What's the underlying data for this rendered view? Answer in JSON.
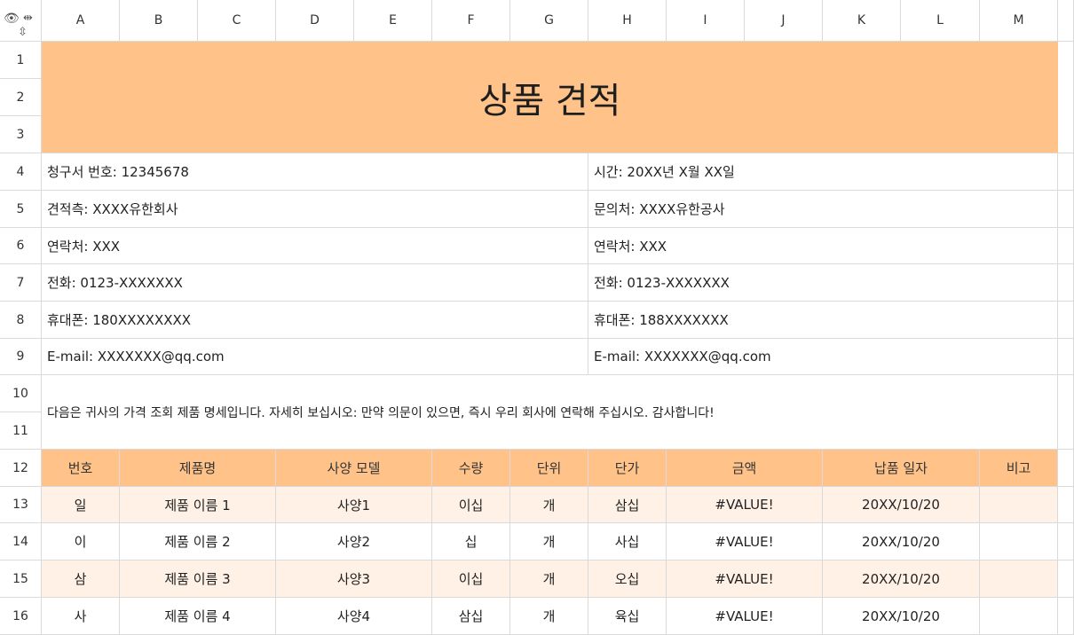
{
  "columns": [
    "A",
    "B",
    "C",
    "D",
    "E",
    "F",
    "G",
    "H",
    "I",
    "J",
    "K",
    "L",
    "M"
  ],
  "rows": [
    "1",
    "2",
    "3",
    "4",
    "5",
    "6",
    "7",
    "8",
    "9",
    "10",
    "11",
    "12",
    "13",
    "14",
    "15",
    "16"
  ],
  "title": "상품 견적",
  "left_info": [
    "청구서 번호: 12345678",
    "견적측: XXXX유한회사",
    "연락처: XXX",
    "전화: 0123-XXXXXXX",
    "휴대폰: 180XXXXXXXX",
    "E-mail: XXXXXXX@qq.com"
  ],
  "right_info": [
    "시간: 20XX년 X월 XX일",
    "문의처: XXXX유한공사",
    "연락처: XXX",
    "전화: 0123-XXXXXXX",
    "휴대폰: 188XXXXXXX",
    "E-mail: XXXXXXX@qq.com"
  ],
  "note": "다음은 귀사의 가격 조회 제품 명세입니다. 자세히 보십시오: 만약 의문이 있으면, 즉시 우리 회사에 연락해 주십시오. 감사합니다!",
  "table_headers": [
    "번호",
    "제품명",
    "사양 모델",
    "수량",
    "단위",
    "단가",
    "금액",
    "납품 일자",
    "비고"
  ],
  "table_rows": [
    [
      "일",
      "제품 이름 1",
      "사양1",
      "이십",
      "개",
      "삼십",
      "#VALUE!",
      "20XX/10/20",
      ""
    ],
    [
      "이",
      "제품 이름 2",
      "사양2",
      "십",
      "개",
      "사십",
      "#VALUE!",
      "20XX/10/20",
      ""
    ],
    [
      "삼",
      "제품 이름 3",
      "사양3",
      "이십",
      "개",
      "오십",
      "#VALUE!",
      "20XX/10/20",
      ""
    ],
    [
      "사",
      "제품 이름 4",
      "사양4",
      "삼십",
      "개",
      "육십",
      "#VALUE!",
      "20XX/10/20",
      ""
    ]
  ],
  "icons": {
    "visibility": "eye-icon",
    "col_resize": "column-resize-icon",
    "row_resize": "row-resize-icon"
  }
}
